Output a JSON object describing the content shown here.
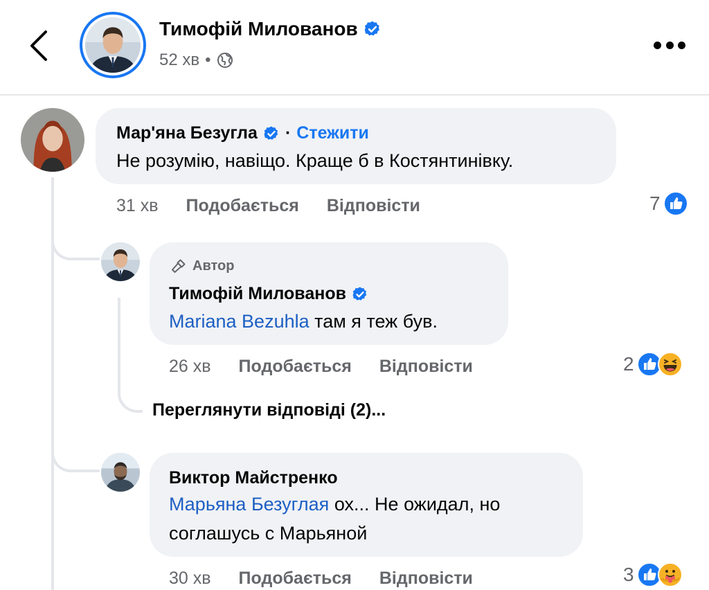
{
  "header": {
    "name": "Тимофій Милованов",
    "time": "52 хв",
    "separator": "•",
    "icons": {
      "back": "chevron-left-icon",
      "verified": "verified-badge-icon",
      "audience": "globe-icon",
      "more": "more-horizontal-icon"
    }
  },
  "colors": {
    "accent": "#1877f2",
    "bubble": "#f0f2f5",
    "muted": "#65676b",
    "thread": "#e4e6eb"
  },
  "comments": [
    {
      "author": "Мар'яна Безугла",
      "separator": "·",
      "follow_label": "Стежити",
      "text": "Не розумію, навіщо. Краще б в Костянтинівку.",
      "time": "31 хв",
      "like_label": "Подобається",
      "reply_label": "Відповісти",
      "reactions_count": "7",
      "reactions": [
        "like-icon"
      ]
    },
    {
      "author_tag": "Автор",
      "author": "Тимофій Милованов",
      "mention": "Mariana Bezuhla",
      "text": "там я теж був.",
      "time": "26 хв",
      "like_label": "Подобається",
      "reply_label": "Відповісти",
      "reactions_count": "2",
      "reactions": [
        "like-icon",
        "haha-icon"
      ]
    },
    {
      "author": "Виктор Майстренко",
      "mention": "Марьяна Безуглая",
      "text_line1": "ох... Не ожидал, но",
      "text_line2": "соглашусь с Марьяной",
      "time": "30 хв",
      "like_label": "Подобається",
      "reply_label": "Відповісти",
      "reactions_count": "3",
      "reactions": [
        "like-icon",
        "care-icon"
      ]
    }
  ],
  "view_replies_label": "Переглянути відповіді (2)..."
}
